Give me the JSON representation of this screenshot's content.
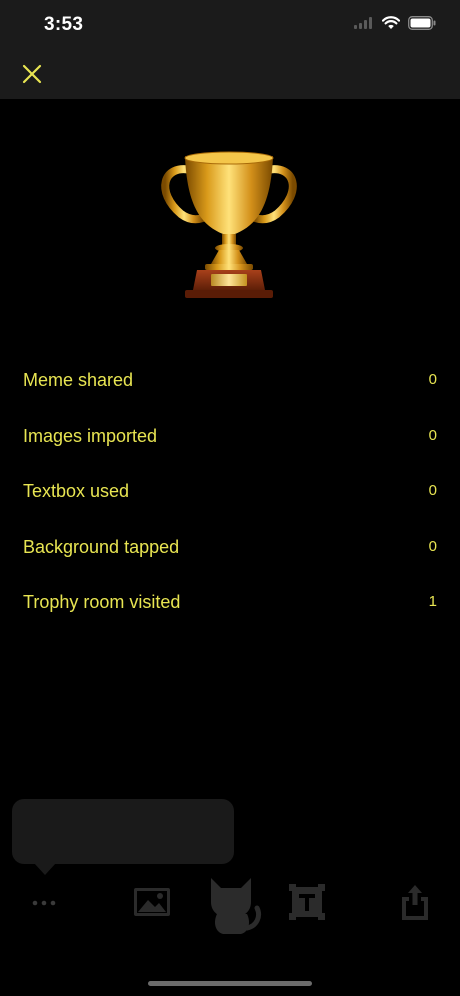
{
  "status_bar": {
    "time": "3:53"
  },
  "nav": {
    "close_icon": "close-x-icon",
    "accent": "#e8e552"
  },
  "trophy": {
    "icon": "trophy-icon"
  },
  "stats": [
    {
      "label": "Meme shared",
      "value": "0"
    },
    {
      "label": "Images imported",
      "value": "0"
    },
    {
      "label": "Textbox used",
      "value": "0"
    },
    {
      "label": "Background tapped",
      "value": "0"
    },
    {
      "label": "Trophy room visited",
      "value": "1"
    }
  ],
  "toolbar": {
    "items": [
      "more-icon",
      "image-icon",
      "cat-icon",
      "text-box-icon",
      "share-icon"
    ]
  },
  "colors": {
    "background": "#000000",
    "bar": "#1b1b1b",
    "accent": "#e8e552",
    "toolbar_icon": "#2b2b2b"
  }
}
